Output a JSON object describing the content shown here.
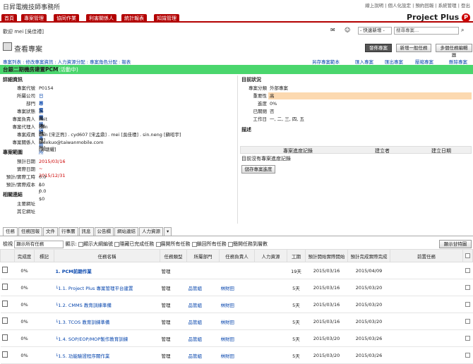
{
  "header": {
    "firm": "日昇電機技師事務所",
    "toplinks": "線上說明 | 個人化設定 | 預約回報 | 系統管理 | 登出",
    "logo": "Project Plus"
  },
  "nav": [
    "首頁",
    "專案管理",
    "協同作業",
    "利害關係人",
    "統計報表",
    "知識管理"
  ],
  "welcome": "歡迎 mei [吳佳禮]",
  "quick": {
    "select": "- 快速新增 -",
    "search_placeholder": "搜尋專案..."
  },
  "page_title": "查看專案",
  "buttons": {
    "publish": "發佈專案",
    "new_task": "新增一般任務",
    "multi_task": "多個任務編輯器",
    "save_progress": "儲存專案進度",
    "show_gantt": "顯示甘特圖"
  },
  "breadcrumbs": "專案列表 : 修改專案資訊 : 人力資源分配 : 專案角色分配 : 報表",
  "actions": [
    "另存專案範本",
    "匯入專案",
    "匯出專案",
    "壓縮專案",
    "刪除專案"
  ],
  "project_name": "台銀二期機房建置PCM",
  "project_name_suffix": "(活動中)",
  "details": {
    "header": "詳細資訊",
    "fields": [
      {
        "label": "專案代號",
        "value": "P0154"
      },
      {
        "label": "所屬公司",
        "value": "日昇電機技師事務所",
        "link": true
      },
      {
        "label": "部門",
        "value": "專案設計組",
        "link": true
      },
      {
        "label": "專案狀態",
        "value": "計畫中"
      },
      {
        "label": "專案負責人",
        "value": "Peit [林財田]"
      },
      {
        "label": "專案代理人",
        "value": "Ben [宋正煦]"
      },
      {
        "label": "專案成員",
        "value": "Ben [宋正煦] . cyd607 [宋孟鼎] . mei [吳佳禮] . sin.neng [蘇昭宇]"
      },
      {
        "label": "專案關係人",
        "value": "alexkuo@taiwanmobile.com [郭聰耀]"
      }
    ],
    "range_header": "專案範圍",
    "range": [
      {
        "label": "預計日期",
        "value": "2015/03/16 ~ 2015/12/31"
      },
      {
        "label": "實際日期",
        "value": ""
      },
      {
        "label": "預計/實際工時",
        "value": "0.0 / 0.0"
      },
      {
        "label": "預計/實際成本",
        "value": "$0 / $0"
      }
    ],
    "links_header": "相關連結",
    "links": [
      {
        "label": "主要網址",
        "value": ""
      },
      {
        "label": "其它網址",
        "value": ""
      }
    ]
  },
  "status": {
    "header": "目前狀況",
    "fields": [
      {
        "label": "專案分類",
        "value": "外部專案"
      },
      {
        "label": "重要性",
        "value": "高"
      },
      {
        "label": "進度",
        "value": "0%"
      },
      {
        "label": "已關閉",
        "value": "否"
      },
      {
        "label": "工作日",
        "value": "一, 二, 三, 四, 五"
      }
    ],
    "desc_header": "描述",
    "progress_cols": [
      "專案進度記錄",
      "建立者",
      "建立日期"
    ],
    "progress_empty": "目前沒有專案進度記錄"
  },
  "tabs": [
    "任務",
    "任務回報",
    "文件",
    "行事曆",
    "訊息",
    "公告欄",
    "網站連結",
    "人力資源"
  ],
  "filter": {
    "label": "檢視",
    "select": "顯示所有任務",
    "display": "顯示:",
    "opts": [
      "顯示大綱編號",
      "隱藏已完成任務",
      "展開所有任務",
      "鎖回所有任務",
      "簡開任務到層數"
    ]
  },
  "table": {
    "cols": [
      "完成度",
      "標記",
      "任務名稱",
      "任務類型",
      "所屬部門",
      "任務負責人",
      "人力資源",
      "工期",
      "預計開始實際開始",
      "預計完成實際完成",
      "前置任務"
    ],
    "rows": [
      {
        "pct": "0%",
        "name": "1. PCM前期作業",
        "type": "管理",
        "dept": "",
        "owner": "",
        "dur": "19天",
        "start": "2015/03/16",
        "end": "2015/04/09",
        "bold": true
      },
      {
        "pct": "0%",
        "name": "└1.1. Project Plus 專案管理平台建置",
        "type": "管理",
        "dept": "品管組",
        "owner": "林財田",
        "dur": "5天",
        "start": "2015/03/16",
        "end": "2015/03/20"
      },
      {
        "pct": "0%",
        "name": "└1.2. CMMS 教育訓練準備",
        "type": "管理",
        "dept": "品管組",
        "owner": "林財田",
        "dur": "5天",
        "start": "2015/03/16",
        "end": "2015/03/20"
      },
      {
        "pct": "0%",
        "name": "└1.3. TCOS 教育訓練準備",
        "type": "管理",
        "dept": "品管組",
        "owner": "林財田",
        "dur": "5天",
        "start": "2015/03/16",
        "end": "2015/03/20"
      },
      {
        "pct": "0%",
        "name": "└1.4. SOP/EOP/MOP製作教育訓練",
        "type": "管理",
        "dept": "品管組",
        "owner": "林財田",
        "dur": "5天",
        "start": "2015/03/20",
        "end": "2015/03/26"
      },
      {
        "pct": "0%",
        "name": "└1.5. 功能驗證程序關作業",
        "type": "管理",
        "dept": "品管組",
        "owner": "林財田",
        "dur": "5天",
        "start": "2015/03/20",
        "end": "2015/03/26"
      }
    ]
  }
}
